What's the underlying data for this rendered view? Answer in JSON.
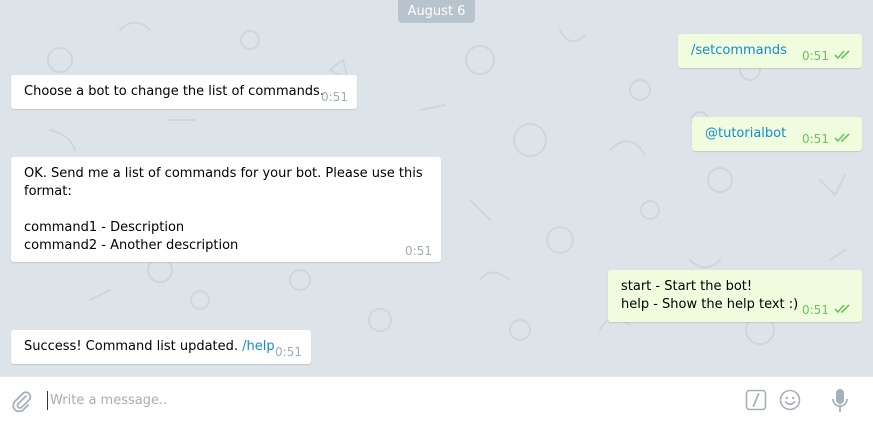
{
  "chat": {
    "date_divider": "August 6",
    "messages": [
      {
        "direction": "out",
        "lines": [
          "/setcommands"
        ],
        "time": "0:51",
        "read": true
      },
      {
        "direction": "in",
        "lines": [
          "Choose a bot to change the list of commands."
        ],
        "time": "0:51"
      },
      {
        "direction": "out",
        "lines": [
          "@tutorialbot"
        ],
        "time": "0:51",
        "read": true
      },
      {
        "direction": "in",
        "lines": [
          "OK. Send me a list of commands for your bot. Please use this",
          "format:",
          "",
          "command1 - Description",
          "command2 - Another description"
        ],
        "time": "0:51"
      },
      {
        "direction": "out",
        "lines": [
          "start - Start the bot!",
          "help - Show the help text :)"
        ],
        "time": "0:51",
        "read": true
      },
      {
        "direction": "in",
        "lines": [
          "Success! Command list updated. "
        ],
        "link": "/help",
        "time": "0:51"
      }
    ]
  },
  "composer": {
    "placeholder": "Write a message..",
    "value": ""
  },
  "icons": {
    "attach": "paperclip-icon",
    "commands": "slash-command-icon",
    "emoji": "smiley-icon",
    "voice": "microphone-icon",
    "read_receipt": "double-check-icon"
  },
  "colors": {
    "link": "#168acd",
    "outgoing_bubble": "#effdde",
    "read_check": "#6cc264",
    "date_pill": "#b7c3cd"
  }
}
